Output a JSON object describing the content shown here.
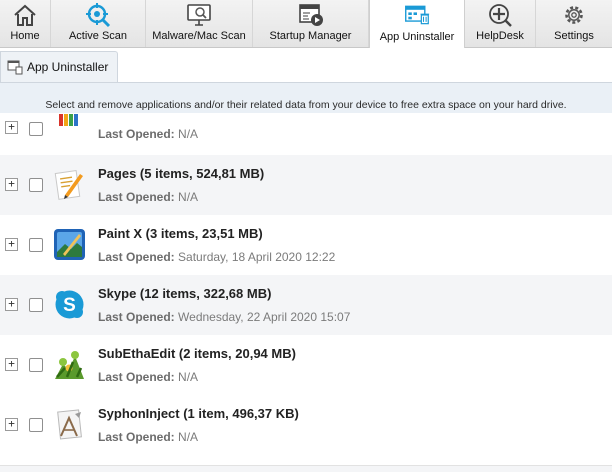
{
  "toolbar": {
    "items": [
      {
        "label": "Home",
        "icon": "home-icon"
      },
      {
        "label": "Active Scan",
        "icon": "scan-target-icon"
      },
      {
        "label": "Malware/Mac Scan",
        "icon": "monitor-scan-icon"
      },
      {
        "label": "Startup Manager",
        "icon": "startup-manager-icon"
      },
      {
        "label": "App Uninstaller",
        "icon": "app-uninstaller-icon",
        "active": true
      },
      {
        "label": "HelpDesk",
        "icon": "helpdesk-icon"
      },
      {
        "label": "Settings",
        "icon": "gear-icon"
      }
    ]
  },
  "subtab": {
    "label": "App Uninstaller",
    "icon": "uninstaller-tab-icon"
  },
  "description": "Select and remove applications and/or their related data from your device to free extra space on your hard drive.",
  "last_opened_label": "Last Opened:",
  "apps": [
    {
      "name": "",
      "last_opened": "N/A",
      "icon": "partial-app-icon"
    },
    {
      "name": "Pages (5 items, 524,81 MB)",
      "last_opened": "N/A",
      "icon": "pages-icon"
    },
    {
      "name": "Paint X (3 items, 23,51 MB)",
      "last_opened": "Saturday, 18 April 2020 12:22",
      "icon": "paint-x-icon"
    },
    {
      "name": "Skype (12 items, 322,68 MB)",
      "last_opened": "Wednesday, 22 April 2020 15:07",
      "icon": "skype-icon"
    },
    {
      "name": "SubEthaEdit (2 items, 20,94 MB)",
      "last_opened": "N/A",
      "icon": "subethaedit-icon"
    },
    {
      "name": "SyphonInject (1 item, 496,37 KB)",
      "last_opened": "N/A",
      "icon": "syphoninject-icon"
    }
  ],
  "colors": {
    "accent_blue": "#1a9ad6",
    "selected_tab_bg": "#ffffff",
    "band_bg": "#eaf0f6",
    "alt_row_bg": "#f4f5f7"
  }
}
